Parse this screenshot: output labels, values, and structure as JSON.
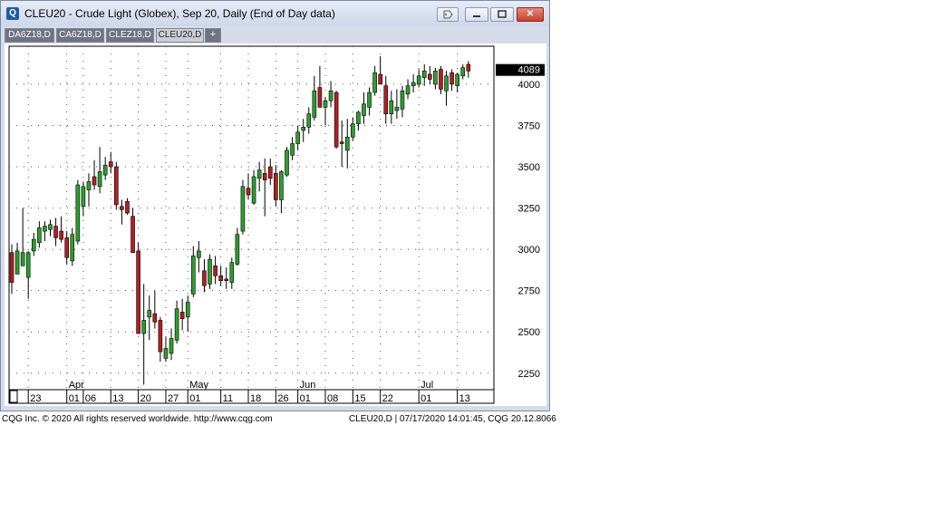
{
  "window": {
    "title": "CLEU20 - Crude Light (Globex), Sep 20, Daily (End of Day data)",
    "icon_letter": "Q",
    "buttons": [
      "tag-icon",
      "minimize-icon",
      "restore-icon",
      "close-icon"
    ],
    "close_label": "✕"
  },
  "tabs": [
    {
      "label": "DA6Z18,D",
      "active": false
    },
    {
      "label": "CA6Z18,D",
      "active": false
    },
    {
      "label": "CLEZ18,D",
      "active": false
    },
    {
      "label": "CLEU20,D",
      "active": true
    }
  ],
  "add_tab_label": "+",
  "chart_data": {
    "type": "candlestick",
    "ylim": [
      2150,
      4230
    ],
    "yticks": [
      2250,
      2500,
      2750,
      3000,
      3250,
      3500,
      3750,
      4000
    ],
    "last_price": 4089,
    "last_price_color": "#000000",
    "up_color": "#2e9e2e",
    "down_color": "#b21f24",
    "grid": "dotted",
    "x_day_labels": [
      {
        "label": "23",
        "bar": 3
      },
      {
        "label": "01",
        "bar": 10
      },
      {
        "label": "06",
        "bar": 13
      },
      {
        "label": "13",
        "bar": 18
      },
      {
        "label": "20",
        "bar": 23
      },
      {
        "label": "27",
        "bar": 28
      },
      {
        "label": "01",
        "bar": 32
      },
      {
        "label": "11",
        "bar": 38
      },
      {
        "label": "18",
        "bar": 43
      },
      {
        "label": "26",
        "bar": 48
      },
      {
        "label": "01",
        "bar": 52
      },
      {
        "label": "08",
        "bar": 57
      },
      {
        "label": "15",
        "bar": 62
      },
      {
        "label": "22",
        "bar": 67
      },
      {
        "label": "01",
        "bar": 74
      },
      {
        "label": "13",
        "bar": 81
      }
    ],
    "x_month_labels": [
      {
        "label": "Apr",
        "bar": 10
      },
      {
        "label": "May",
        "bar": 32
      },
      {
        "label": "Jun",
        "bar": 52
      },
      {
        "label": "Jul",
        "bar": 74
      }
    ],
    "candles": [
      {
        "o": 2980,
        "h": 3030,
        "l": 2730,
        "c": 2800
      },
      {
        "o": 2850,
        "h": 3040,
        "l": 2850,
        "c": 2990
      },
      {
        "o": 2900,
        "h": 3250,
        "l": 2900,
        "c": 2980
      },
      {
        "o": 2830,
        "h": 2990,
        "l": 2700,
        "c": 2980
      },
      {
        "o": 2990,
        "h": 3100,
        "l": 2960,
        "c": 3060
      },
      {
        "o": 3040,
        "h": 3170,
        "l": 3010,
        "c": 3130
      },
      {
        "o": 3110,
        "h": 3170,
        "l": 3050,
        "c": 3140
      },
      {
        "o": 3120,
        "h": 3180,
        "l": 3080,
        "c": 3150
      },
      {
        "o": 3140,
        "h": 3190,
        "l": 3020,
        "c": 3070
      },
      {
        "o": 3110,
        "h": 3200,
        "l": 3040,
        "c": 3060
      },
      {
        "o": 3070,
        "h": 3110,
        "l": 2910,
        "c": 2950
      },
      {
        "o": 2930,
        "h": 3130,
        "l": 2900,
        "c": 3090
      },
      {
        "o": 3050,
        "h": 3420,
        "l": 3030,
        "c": 3390
      },
      {
        "o": 3260,
        "h": 3410,
        "l": 3200,
        "c": 3380
      },
      {
        "o": 3360,
        "h": 3460,
        "l": 3260,
        "c": 3410
      },
      {
        "o": 3440,
        "h": 3540,
        "l": 3360,
        "c": 3390
      },
      {
        "o": 3380,
        "h": 3620,
        "l": 3340,
        "c": 3470
      },
      {
        "o": 3450,
        "h": 3560,
        "l": 3420,
        "c": 3510
      },
      {
        "o": 3530,
        "h": 3590,
        "l": 3460,
        "c": 3500
      },
      {
        "o": 3500,
        "h": 3530,
        "l": 3240,
        "c": 3270
      },
      {
        "o": 3260,
        "h": 3300,
        "l": 3150,
        "c": 3240
      },
      {
        "o": 3290,
        "h": 3310,
        "l": 3210,
        "c": 3220
      },
      {
        "o": 3200,
        "h": 3250,
        "l": 3000,
        "c": 2980
      },
      {
        "o": 2990,
        "h": 3040,
        "l": 2490,
        "c": 2490
      },
      {
        "o": 2490,
        "h": 2790,
        "l": 2180,
        "c": 2570
      },
      {
        "o": 2590,
        "h": 2720,
        "l": 2450,
        "c": 2630
      },
      {
        "o": 2610,
        "h": 2750,
        "l": 2520,
        "c": 2560
      },
      {
        "o": 2570,
        "h": 2590,
        "l": 2320,
        "c": 2380
      },
      {
        "o": 2340,
        "h": 2470,
        "l": 2320,
        "c": 2400
      },
      {
        "o": 2370,
        "h": 2520,
        "l": 2330,
        "c": 2460
      },
      {
        "o": 2450,
        "h": 2690,
        "l": 2430,
        "c": 2640
      },
      {
        "o": 2620,
        "h": 2700,
        "l": 2510,
        "c": 2580
      },
      {
        "o": 2590,
        "h": 2720,
        "l": 2500,
        "c": 2680
      },
      {
        "o": 2730,
        "h": 3020,
        "l": 2710,
        "c": 2960
      },
      {
        "o": 2950,
        "h": 3050,
        "l": 2860,
        "c": 2990
      },
      {
        "o": 2870,
        "h": 2940,
        "l": 2740,
        "c": 2780
      },
      {
        "o": 2790,
        "h": 2970,
        "l": 2760,
        "c": 2940
      },
      {
        "o": 2900,
        "h": 2960,
        "l": 2790,
        "c": 2840
      },
      {
        "o": 2840,
        "h": 2900,
        "l": 2780,
        "c": 2810
      },
      {
        "o": 2820,
        "h": 2890,
        "l": 2760,
        "c": 2810
      },
      {
        "o": 2800,
        "h": 2950,
        "l": 2760,
        "c": 2920
      },
      {
        "o": 2910,
        "h": 3130,
        "l": 2900,
        "c": 3090
      },
      {
        "o": 3110,
        "h": 3420,
        "l": 3090,
        "c": 3380
      },
      {
        "o": 3370,
        "h": 3460,
        "l": 3300,
        "c": 3330
      },
      {
        "o": 3280,
        "h": 3480,
        "l": 3270,
        "c": 3440
      },
      {
        "o": 3430,
        "h": 3530,
        "l": 3350,
        "c": 3480
      },
      {
        "o": 3460,
        "h": 3550,
        "l": 3200,
        "c": 3420
      },
      {
        "o": 3500,
        "h": 3550,
        "l": 3390,
        "c": 3430
      },
      {
        "o": 3460,
        "h": 3510,
        "l": 3260,
        "c": 3300
      },
      {
        "o": 3300,
        "h": 3480,
        "l": 3220,
        "c": 3470
      },
      {
        "o": 3450,
        "h": 3620,
        "l": 3440,
        "c": 3600
      },
      {
        "o": 3570,
        "h": 3680,
        "l": 3540,
        "c": 3640
      },
      {
        "o": 3640,
        "h": 3750,
        "l": 3600,
        "c": 3710
      },
      {
        "o": 3720,
        "h": 3790,
        "l": 3650,
        "c": 3740
      },
      {
        "o": 3740,
        "h": 3860,
        "l": 3700,
        "c": 3820
      },
      {
        "o": 3800,
        "h": 4050,
        "l": 3780,
        "c": 3960
      },
      {
        "o": 3980,
        "h": 4110,
        "l": 3880,
        "c": 3860
      },
      {
        "o": 3860,
        "h": 3920,
        "l": 3750,
        "c": 3900
      },
      {
        "o": 3900,
        "h": 4020,
        "l": 3860,
        "c": 3960
      },
      {
        "o": 3950,
        "h": 3960,
        "l": 3610,
        "c": 3620
      },
      {
        "o": 3650,
        "h": 3780,
        "l": 3500,
        "c": 3640
      },
      {
        "o": 3600,
        "h": 3790,
        "l": 3490,
        "c": 3680
      },
      {
        "o": 3680,
        "h": 3800,
        "l": 3660,
        "c": 3760
      },
      {
        "o": 3760,
        "h": 3840,
        "l": 3720,
        "c": 3830
      },
      {
        "o": 3810,
        "h": 3950,
        "l": 3760,
        "c": 3880
      },
      {
        "o": 3860,
        "h": 3980,
        "l": 3810,
        "c": 3950
      },
      {
        "o": 3950,
        "h": 4110,
        "l": 3930,
        "c": 4070
      },
      {
        "o": 4060,
        "h": 4170,
        "l": 4000,
        "c": 4000
      },
      {
        "o": 3990,
        "h": 4050,
        "l": 3760,
        "c": 3820
      },
      {
        "o": 3820,
        "h": 3960,
        "l": 3760,
        "c": 3900
      },
      {
        "o": 3840,
        "h": 3970,
        "l": 3790,
        "c": 3860
      },
      {
        "o": 3850,
        "h": 3990,
        "l": 3800,
        "c": 3960
      },
      {
        "o": 3940,
        "h": 4030,
        "l": 3910,
        "c": 3990
      },
      {
        "o": 3990,
        "h": 4060,
        "l": 3950,
        "c": 4010
      },
      {
        "o": 4000,
        "h": 4090,
        "l": 3980,
        "c": 4050
      },
      {
        "o": 4040,
        "h": 4120,
        "l": 3990,
        "c": 4080
      },
      {
        "o": 4060,
        "h": 4110,
        "l": 4000,
        "c": 4030
      },
      {
        "o": 4000,
        "h": 4100,
        "l": 3970,
        "c": 4080
      },
      {
        "o": 4090,
        "h": 4110,
        "l": 3940,
        "c": 3970
      },
      {
        "o": 3960,
        "h": 4080,
        "l": 3870,
        "c": 4050
      },
      {
        "o": 4070,
        "h": 4090,
        "l": 3960,
        "c": 4000
      },
      {
        "o": 3990,
        "h": 4070,
        "l": 3950,
        "c": 4060
      },
      {
        "o": 4050,
        "h": 4120,
        "l": 4030,
        "c": 4100
      },
      {
        "o": 4120,
        "h": 4140,
        "l": 4040,
        "c": 4080
      }
    ]
  },
  "footer": {
    "left": "CQG Inc. © 2020 All rights reserved worldwide. http://www.cqg.com",
    "right": "CLEU20,D | 07/17/2020 14:01:45, CQG 20.12.8066"
  }
}
